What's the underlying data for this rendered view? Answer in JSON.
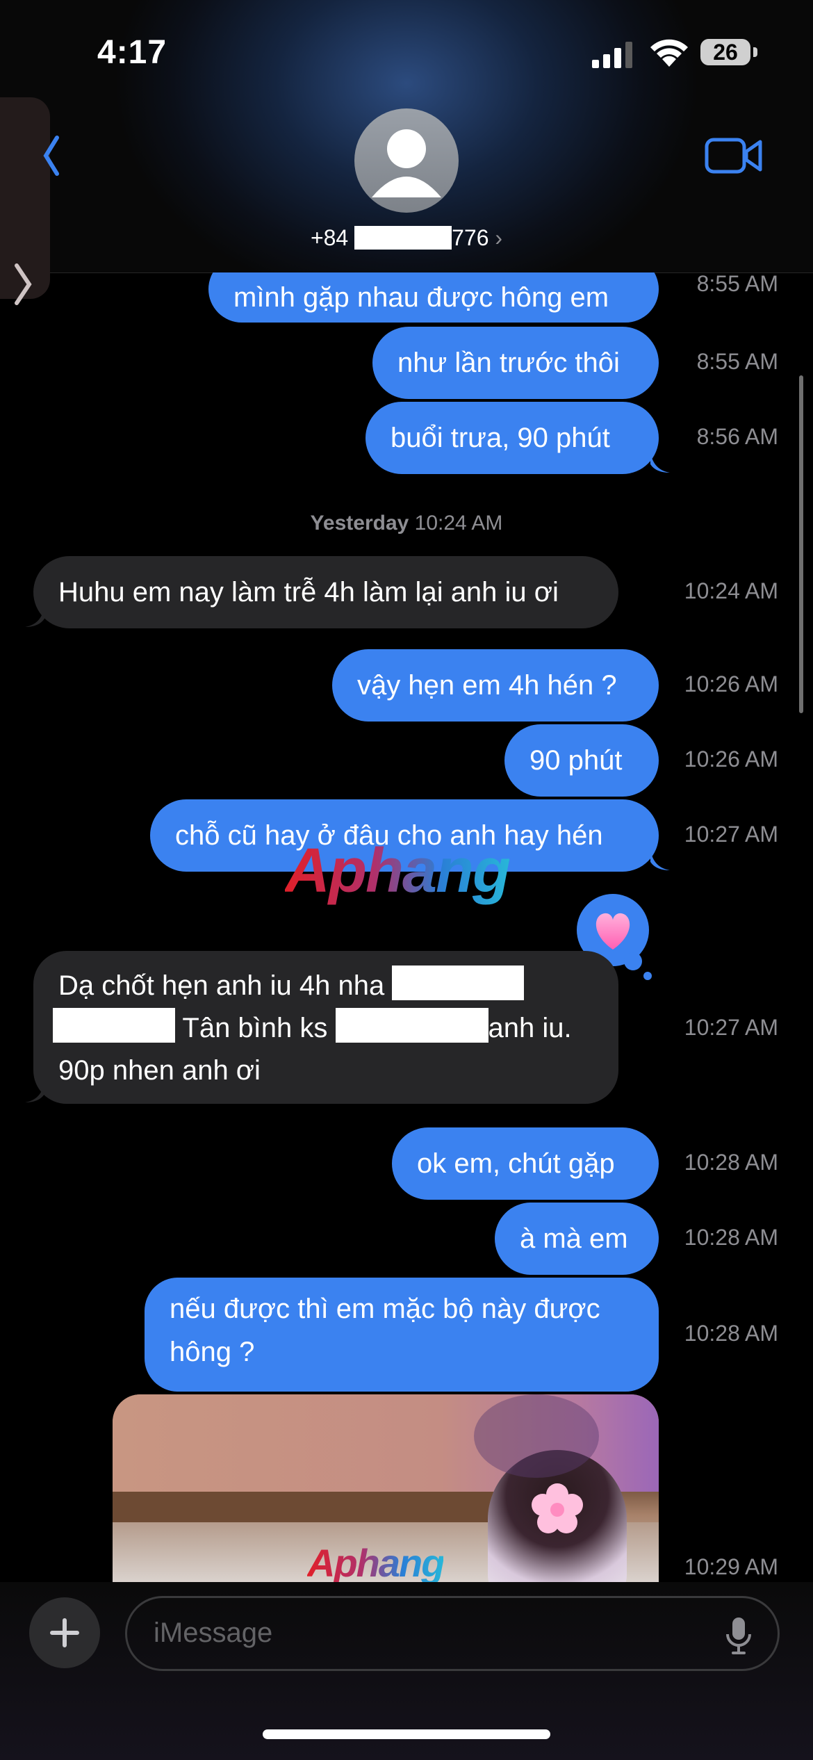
{
  "status_bar": {
    "time": "4:17",
    "battery": "26"
  },
  "header": {
    "contact_prefix": "+84",
    "contact_suffix": "776",
    "chevron": "›"
  },
  "messages": [
    {
      "text": "mình gặp nhau được hông em",
      "time": "8:55 AM"
    },
    {
      "text": "như lần trước thôi",
      "time": "8:55 AM"
    },
    {
      "text": "buổi trưa, 90 phút",
      "time": "8:56 AM"
    },
    {
      "text": "Huhu em nay làm trễ 4h làm lại anh iu ơi",
      "time": "10:24 AM"
    },
    {
      "text": "vậy hẹn em 4h hén ?",
      "time": "10:26 AM"
    },
    {
      "text": "90 phút",
      "time": "10:26 AM"
    },
    {
      "text": "chỗ cũ hay ở đâu cho anh hay hén",
      "time": "10:27 AM"
    },
    {
      "line1": "Dạ chốt hẹn anh iu 4h nha",
      "line2a": "Tân bình ks",
      "line2b": "anh iu.",
      "line3": "90p nhen anh ơi",
      "time": "10:27 AM"
    },
    {
      "text": "ok em, chút gặp",
      "time": "10:28 AM"
    },
    {
      "text": "à mà em",
      "time": "10:28 AM"
    },
    {
      "line1": "nếu được thì em mặc bộ này được",
      "line2": "hông ?",
      "time": "10:28 AM"
    },
    {
      "time": "10:29 AM"
    }
  ],
  "day_separator": {
    "day": "Yesterday",
    "time": "10:24 AM"
  },
  "reaction": {
    "icon": "heart-icon"
  },
  "watermark": {
    "text": "Aphang"
  },
  "compose": {
    "placeholder": "iMessage"
  },
  "colors": {
    "outgoing_bubble": "#3b82f0",
    "incoming_bubble": "#262628",
    "accent": "#3b82f0"
  }
}
